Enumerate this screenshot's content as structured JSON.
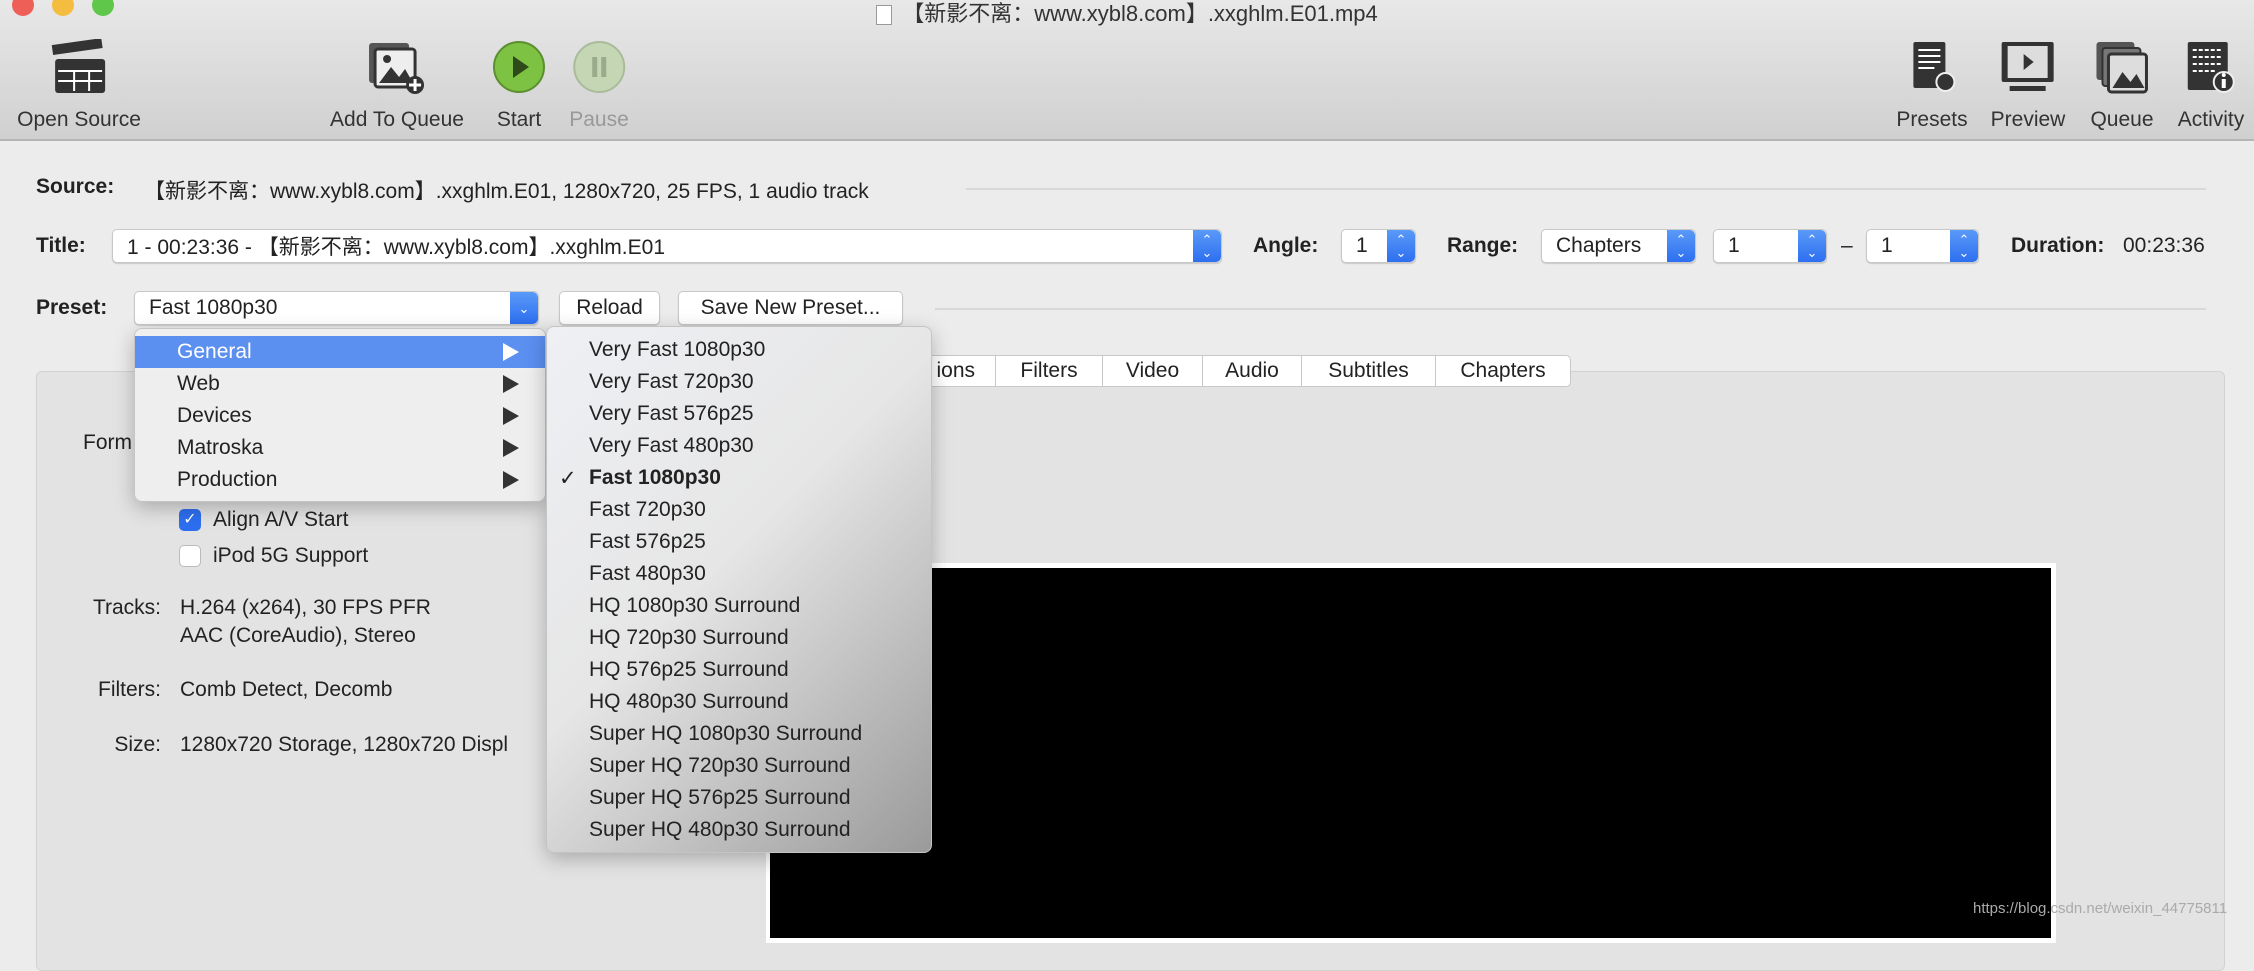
{
  "window": {
    "title": "【新影不离：www.xybl8.com】.xxghlm.E01.mp4"
  },
  "toolbar": {
    "open_source": "Open Source",
    "add_to_queue": "Add To Queue",
    "start": "Start",
    "pause": "Pause",
    "presets": "Presets",
    "preview": "Preview",
    "queue": "Queue",
    "activity": "Activity"
  },
  "source": {
    "label": "Source:",
    "value": "【新影不离：www.xybl8.com】.xxghlm.E01, 1280x720, 25 FPS, 1 audio track"
  },
  "title_row": {
    "label": "Title:",
    "value": "1 - 00:23:36 - 【新影不离：www.xybl8.com】.xxghlm.E01",
    "angle_label": "Angle:",
    "angle": "1",
    "range_label": "Range:",
    "range_type": "Chapters",
    "range_start": "1",
    "range_dash": "–",
    "range_end": "1",
    "duration_label": "Duration:",
    "duration": "00:23:36"
  },
  "preset_row": {
    "label": "Preset:",
    "value": "Fast 1080p30",
    "reload": "Reload",
    "save_new": "Save New Preset..."
  },
  "preset_menu": {
    "categories": [
      {
        "label": "General",
        "highlighted": true
      },
      {
        "label": "Web"
      },
      {
        "label": "Devices"
      },
      {
        "label": "Matroska"
      },
      {
        "label": "Production"
      }
    ],
    "general_items": [
      "Very Fast 1080p30",
      "Very Fast 720p30",
      "Very Fast 576p25",
      "Very Fast 480p30",
      "Fast 1080p30",
      "Fast 720p30",
      "Fast 576p25",
      "Fast 480p30",
      "HQ 1080p30 Surround",
      "HQ 720p30 Surround",
      "HQ 576p25 Surround",
      "HQ 480p30 Surround",
      "Super HQ 1080p30 Surround",
      "Super HQ 720p30 Surround",
      "Super HQ 576p25 Surround",
      "Super HQ 480p30 Surround"
    ],
    "selected": "Fast 1080p30",
    "check": "✓"
  },
  "tabs": [
    "ions",
    "Filters",
    "Video",
    "Audio",
    "Subtitles",
    "Chapters"
  ],
  "summary": {
    "format_label": "Form",
    "align_av": {
      "label": "Align A/V Start",
      "checked": true
    },
    "ipod": {
      "label": "iPod 5G Support",
      "checked": false
    },
    "tracks_label": "Tracks:",
    "tracks": [
      "H.264 (x264), 30 FPS PFR",
      "AAC (CoreAudio), Stereo"
    ],
    "filters_label": "Filters:",
    "filters": "Comb Detect, Decomb",
    "size_label": "Size:",
    "size": "1280x720 Storage, 1280x720 Displ"
  },
  "watermark": "https://blog.csdn.net/weixin_44775811",
  "colors": {
    "accent": "#2d6ff0",
    "menu_highlight": "#5b8ff0",
    "start_green": "#7dc243"
  }
}
